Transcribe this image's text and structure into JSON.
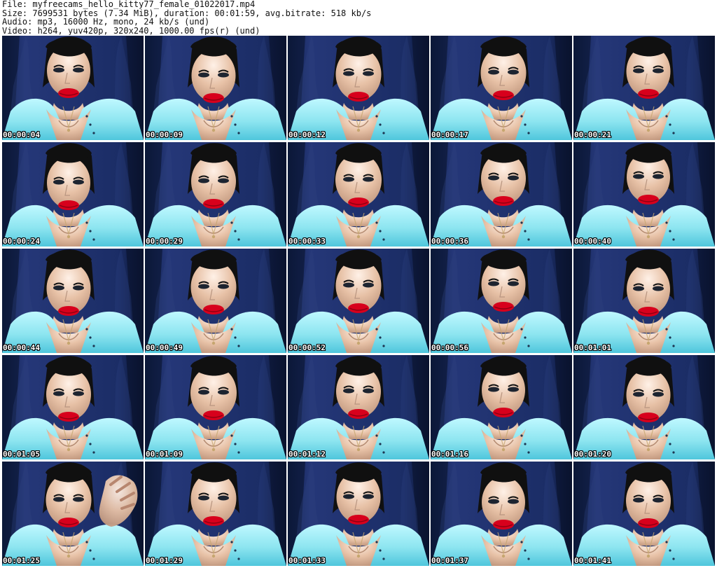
{
  "header": {
    "file_line": "File: myfreecams_hello_kitty77_female_01022017.mp4",
    "size_line": "Size: 7699531 bytes (7.34 MiB), duration: 00:01:59, avg.bitrate: 518 kb/s",
    "audio_line": "Audio: mp3, 16000 Hz, mono, 24 kb/s (und)",
    "video_line": "Video: h264, yuv420p, 320x240, 1000.00 fps(r) (und)"
  },
  "thumbnails": [
    {
      "timestamp": "00:00:04"
    },
    {
      "timestamp": "00:00:09"
    },
    {
      "timestamp": "00:00:12"
    },
    {
      "timestamp": "00:00:17"
    },
    {
      "timestamp": "00:00:21"
    },
    {
      "timestamp": "00:00:24"
    },
    {
      "timestamp": "00:00:29"
    },
    {
      "timestamp": "00:00:33"
    },
    {
      "timestamp": "00:00:36"
    },
    {
      "timestamp": "00:00:40"
    },
    {
      "timestamp": "00:00:44"
    },
    {
      "timestamp": "00:00:49"
    },
    {
      "timestamp": "00:00:52"
    },
    {
      "timestamp": "00:00:56"
    },
    {
      "timestamp": "00:01:01"
    },
    {
      "timestamp": "00:01:05"
    },
    {
      "timestamp": "00:01:09"
    },
    {
      "timestamp": "00:01:12"
    },
    {
      "timestamp": "00:01:16"
    },
    {
      "timestamp": "00:01:20"
    },
    {
      "timestamp": "00:01:25"
    },
    {
      "timestamp": "00:01:29"
    },
    {
      "timestamp": "00:01:33"
    },
    {
      "timestamp": "00:01:37"
    },
    {
      "timestamp": "00:01:41"
    }
  ],
  "colors": {
    "background": "#ffffff",
    "header_text": "#111111",
    "timestamp_text": "#ffffff",
    "timestamp_outline": "#000000",
    "backdrop_blue": "#0f1b3a",
    "shirt": "#8de5f0",
    "skin": "#e7c1a6",
    "hair": "#101010",
    "lips": "#d7001c"
  }
}
